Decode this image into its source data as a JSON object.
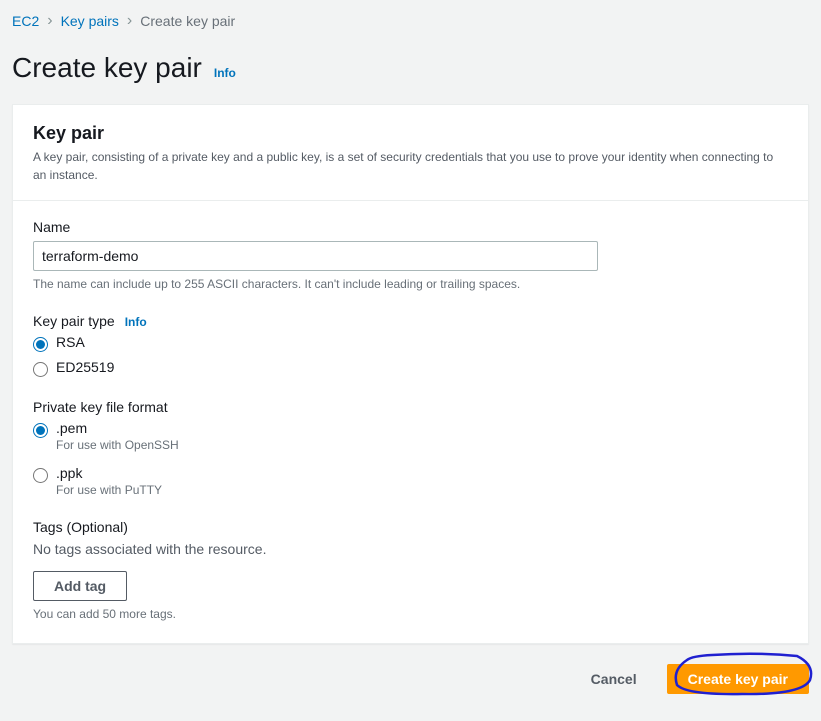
{
  "breadcrumb": {
    "ec2": "EC2",
    "keypairs": "Key pairs",
    "current": "Create key pair"
  },
  "page": {
    "title": "Create key pair",
    "info": "Info"
  },
  "panel": {
    "title": "Key pair",
    "description": "A key pair, consisting of a private key and a public key, is a set of security credentials that you use to prove your identity when connecting to an instance."
  },
  "form": {
    "name": {
      "label": "Name",
      "value": "terraform-demo",
      "help": "The name can include up to 255 ASCII characters. It can't include leading or trailing spaces."
    },
    "keyType": {
      "label": "Key pair type",
      "info": "Info",
      "options": {
        "rsa": "RSA",
        "ed25519": "ED25519"
      }
    },
    "fileFormat": {
      "label": "Private key file format",
      "options": {
        "pem": {
          "label": ".pem",
          "sub": "For use with OpenSSH"
        },
        "ppk": {
          "label": ".ppk",
          "sub": "For use with PuTTY"
        }
      }
    },
    "tags": {
      "label": "Tags (Optional)",
      "empty": "No tags associated with the resource.",
      "addButton": "Add tag",
      "limit": "You can add 50 more tags."
    }
  },
  "actions": {
    "cancel": "Cancel",
    "create": "Create key pair"
  }
}
